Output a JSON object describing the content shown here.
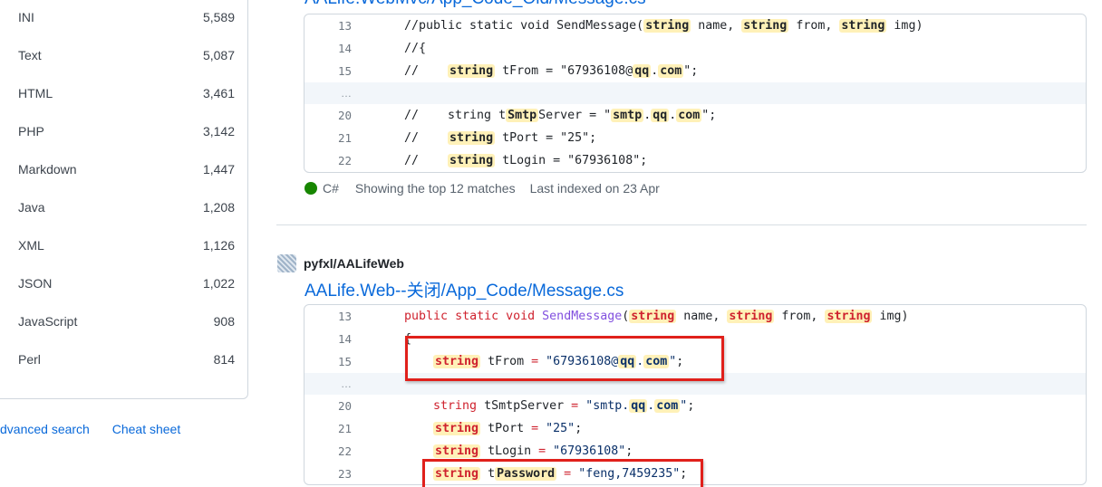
{
  "sidebar": {
    "languages": [
      {
        "name": "INI",
        "count": "5,589"
      },
      {
        "name": "Text",
        "count": "5,087"
      },
      {
        "name": "HTML",
        "count": "3,461"
      },
      {
        "name": "PHP",
        "count": "3,142"
      },
      {
        "name": "Markdown",
        "count": "1,447"
      },
      {
        "name": "Java",
        "count": "1,208"
      },
      {
        "name": "XML",
        "count": "1,126"
      },
      {
        "name": "JSON",
        "count": "1,022"
      },
      {
        "name": "JavaScript",
        "count": "908"
      },
      {
        "name": "Perl",
        "count": "814"
      }
    ],
    "advanced_search": "dvanced search",
    "cheat_sheet": "Cheat sheet"
  },
  "result1": {
    "file_path": "AALife.WebMvc/App_Code_Old/Message.cs",
    "line_numbers": [
      "13",
      "14",
      "15",
      "…",
      "20",
      "21",
      "22"
    ],
    "language": "C#",
    "language_color": "#178600",
    "matches_text": "Showing the top 12 matches",
    "indexed_text": "Last indexed on 23 Apr"
  },
  "result2": {
    "repo": "pyfxl/AALifeWeb",
    "file_path": "AALife.Web--关闭/App_Code/Message.cs",
    "line_numbers": [
      "13",
      "14",
      "15",
      "…",
      "20",
      "21",
      "22",
      "23"
    ]
  },
  "colors": {
    "link": "#0969da",
    "highlight": "#fff1b8",
    "annotation_box": "#e0201b"
  }
}
